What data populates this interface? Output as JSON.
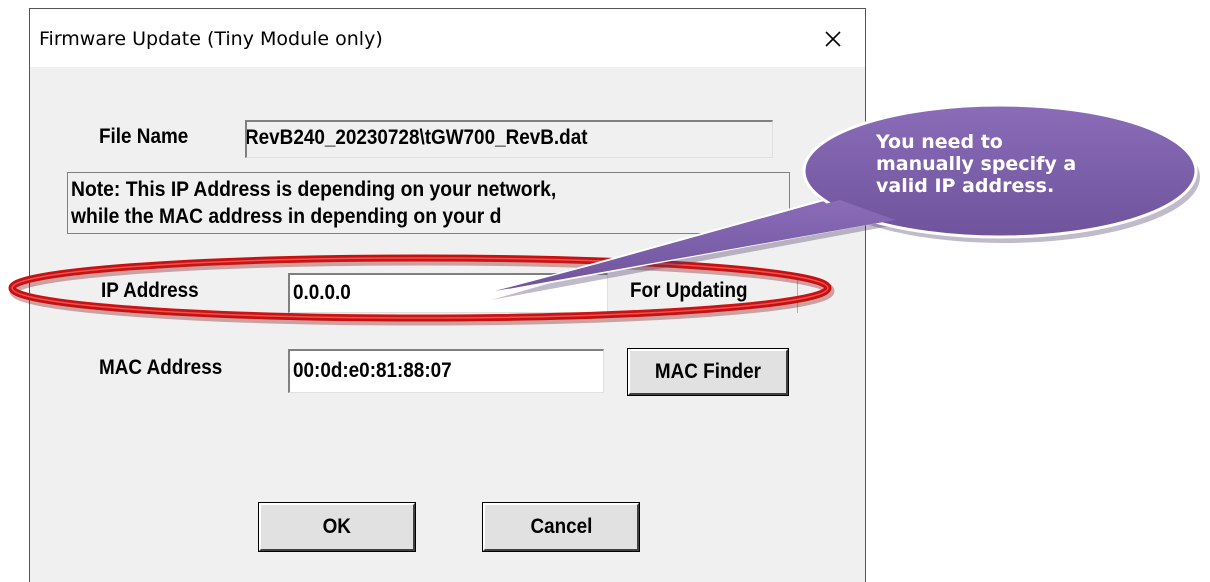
{
  "window": {
    "title": "Firmware Update (Tiny Module only)",
    "close_icon": "close-icon"
  },
  "file": {
    "label": "File Name",
    "value": "RevB240_20230728\\tGW700_RevB.dat"
  },
  "note": {
    "line1": "Note: This IP Address is depending on your network,",
    "line2": "while the  MAC address in depending on your d"
  },
  "ip": {
    "label": "IP Address",
    "value": "0.0.0.0",
    "side_button": "For Updating"
  },
  "mac": {
    "label": "MAC Address",
    "value": "00:0d:e0:81:88:07",
    "finder_button": "MAC Finder"
  },
  "buttons": {
    "ok": "OK",
    "cancel": "Cancel"
  },
  "callout": {
    "line1": "You need to",
    "line2": "manually specify a",
    "line3": "valid IP address."
  },
  "colors": {
    "callout_fill": "#7b5ea7",
    "highlight_ring": "#e41e1e"
  }
}
